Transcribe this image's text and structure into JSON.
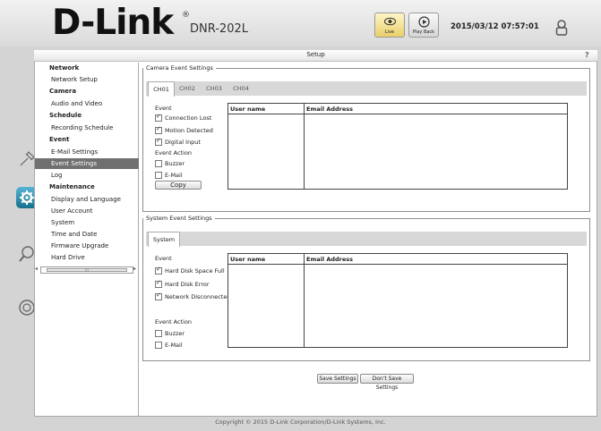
{
  "header": {
    "logo": "D-Link",
    "registered": "®",
    "model": "DNR-202L",
    "live_label": "Live",
    "playback_label": "Play Back",
    "datetime": "2015/03/12 07:57:01"
  },
  "page": {
    "title": "Setup",
    "help": "?"
  },
  "nav": {
    "network": "Network",
    "network_setup": "Network Setup",
    "camera": "Camera",
    "audio_video": "Audio and Video",
    "schedule": "Schedule",
    "recording_schedule": "Recording Schedule",
    "event": "Event",
    "email_settings": "E-Mail Settings",
    "event_settings": "Event Settings",
    "log": "Log",
    "maintenance": "Maintenance",
    "display_language": "Display and Language",
    "user_account": "User Account",
    "system": "System",
    "time_date": "Time and Date",
    "firmware_upgrade": "Firmware Upgrade",
    "hard_drive": "Hard Drive",
    "scroll_grip": "III"
  },
  "camera_events": {
    "legend": "Camera Event Settings",
    "tabs": [
      "CH01",
      "CH02",
      "CH03",
      "CH04"
    ],
    "event_label": "Event",
    "events": [
      "Connection Lost",
      "Motion Detected",
      "Digital Input"
    ],
    "action_label": "Event Action",
    "actions": [
      "Buzzer",
      "E-Mail"
    ],
    "copy": "Copy",
    "col_user": "User name",
    "col_email": "Email Address"
  },
  "system_events": {
    "legend": "System Event Settings",
    "tab": "System",
    "event_label": "Event",
    "events": [
      "Hard Disk Space Full",
      "Hard Disk Error",
      "Network Disconnected."
    ],
    "action_label": "Event Action",
    "actions": [
      "Buzzer",
      "E-Mail"
    ],
    "col_user": "User name",
    "col_email": "Email Address"
  },
  "buttons": {
    "save": "Save Settings",
    "dont_save": "Don't Save Settings"
  },
  "footer": "Copyright © 2015 D-Link Corporation/D-Link Systems, Inc."
}
